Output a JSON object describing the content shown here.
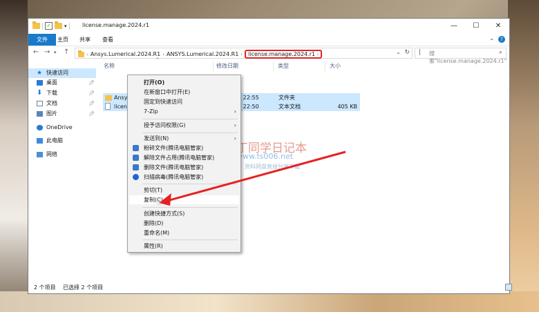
{
  "window": {
    "title": "license.manage.2024.r1",
    "controls": {
      "minimize": "—",
      "maximize": "☐",
      "close": "✕"
    }
  },
  "ribbon": {
    "tabs": [
      "文件",
      "主页",
      "共享",
      "查看"
    ],
    "help": "?"
  },
  "address": {
    "crumbs": [
      "Ansys.Lumerical.2024.R1",
      "ANSYS.Lumerical.2024.R1",
      "license.manage.2024.r1"
    ],
    "search_placeholder": "搜索\"license.manage.2024.r1\""
  },
  "nav_pane": [
    {
      "label": "快速访问",
      "icon": "star-icon"
    },
    {
      "label": "桌面",
      "icon": "desktop-icon",
      "pinned": true
    },
    {
      "label": "下载",
      "icon": "download-icon",
      "pinned": true
    },
    {
      "label": "文档",
      "icon": "document-icon",
      "pinned": true
    },
    {
      "label": "图片",
      "icon": "picture-icon",
      "pinned": true
    },
    {
      "label": "OneDrive",
      "icon": "cloud-icon"
    },
    {
      "label": "此电脑",
      "icon": "computer-icon"
    },
    {
      "label": "网络",
      "icon": "network-icon"
    }
  ],
  "columns": {
    "name": "名称",
    "modified": "修改日期",
    "type": "类型",
    "size": "大小"
  },
  "files": [
    {
      "name": "Ansys",
      "date": "5 22:55",
      "type": "文件夹",
      "size": ""
    },
    {
      "name": "license",
      "date": "5 22:50",
      "type": "文本文档",
      "size": "405 KB"
    }
  ],
  "status": {
    "count": "2 个项目",
    "selected": "已选择 2 个项目"
  },
  "context_menu": [
    {
      "label": "打开(O)",
      "bold": true
    },
    {
      "label": "在新窗口中打开(E)"
    },
    {
      "label": "固定到快速访问"
    },
    {
      "label": "7-Zip",
      "submenu": true
    },
    {
      "sep": true
    },
    {
      "label": "授予访问权限(G)",
      "submenu": true
    },
    {
      "sep": true
    },
    {
      "label": "发送到(N)",
      "submenu": true
    },
    {
      "label": "粉碎文件(腾讯电脑管家)",
      "icon": "shred-icon"
    },
    {
      "label": "解除文件占用(腾讯电脑管家)",
      "icon": "unlock-icon"
    },
    {
      "label": "删除文件(腾讯电脑管家)",
      "icon": "delete-icon"
    },
    {
      "label": "扫描病毒(腾讯电脑管家)",
      "icon": "shield-icon"
    },
    {
      "sep": true
    },
    {
      "label": "剪切(T)"
    },
    {
      "label": "复制(C)",
      "hover": true
    },
    {
      "sep": true
    },
    {
      "label": "创建快捷方式(S)"
    },
    {
      "label": "删除(D)"
    },
    {
      "label": "重命名(M)"
    },
    {
      "sep": true
    },
    {
      "label": "属性(R)"
    }
  ],
  "watermark": {
    "title": "丁同学日记本",
    "url": "www.ts006.net",
    "subtitle": "软件、资源、资料网盘直接分享下载"
  },
  "colors": {
    "accent": "#1979ca",
    "highlight": "#e62121",
    "selection": "#cce8ff"
  }
}
